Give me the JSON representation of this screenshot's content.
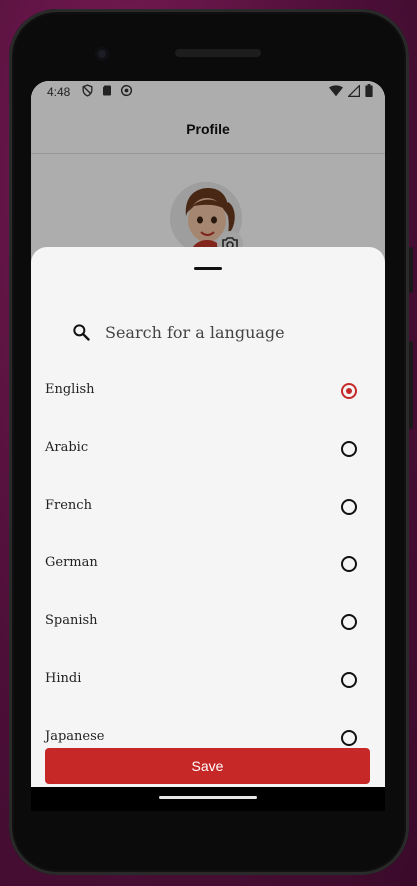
{
  "status_bar": {
    "time": "4:48",
    "left_icons": [
      "shield-icon",
      "sd-card-icon",
      "sync-icon"
    ],
    "right_icons": [
      "wifi-icon",
      "signal-icon",
      "battery-icon"
    ]
  },
  "app_bar": {
    "title": "Profile"
  },
  "profile": {
    "avatar_icon": "avatar-illustration",
    "camera_badge_icon": "camera-icon"
  },
  "language_sheet": {
    "search": {
      "placeholder": "Search for a language",
      "value": ""
    },
    "languages": [
      {
        "label": "English",
        "selected": true
      },
      {
        "label": "Arabic",
        "selected": false
      },
      {
        "label": "French",
        "selected": false
      },
      {
        "label": "German",
        "selected": false
      },
      {
        "label": "Spanish",
        "selected": false
      },
      {
        "label": "Hindi",
        "selected": false
      },
      {
        "label": "Japanese",
        "selected": false
      }
    ],
    "save_label": "Save"
  },
  "colors": {
    "accent": "#c62828",
    "sheet_background": "#f5f5f5",
    "scrim": "rgba(0,0,0,0.32)"
  }
}
